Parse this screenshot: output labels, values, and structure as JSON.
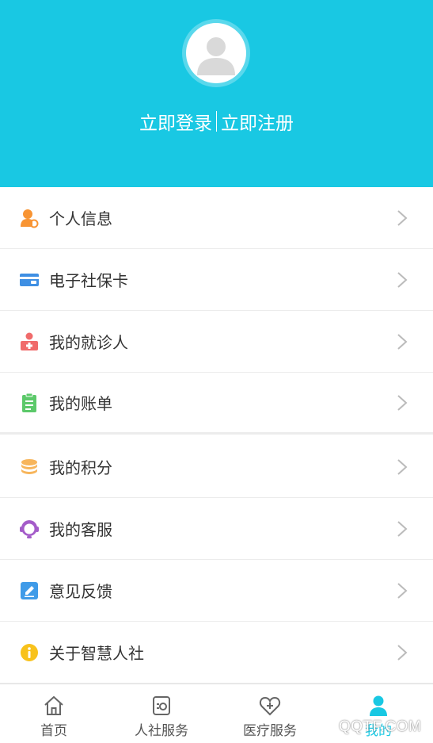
{
  "header": {
    "login_label": "立即登录",
    "register_label": "立即注册",
    "background_color": "#19c8e3"
  },
  "menu": {
    "items": [
      {
        "label": "个人信息",
        "icon": "person-info-icon",
        "color": "#f89433"
      },
      {
        "label": "电子社保卡",
        "icon": "social-security-card-icon",
        "color": "#3f8fe3"
      },
      {
        "label": "我的就诊人",
        "icon": "patient-icon",
        "color": "#f06b6b"
      },
      {
        "label": "我的账单",
        "icon": "bill-clipboard-icon",
        "color": "#5cc96a"
      },
      {
        "label": "我的积分",
        "icon": "points-coins-icon",
        "color": "#f7b55b"
      },
      {
        "label": "我的客服",
        "icon": "customer-service-icon",
        "color": "#a45cc9"
      },
      {
        "label": "意见反馈",
        "icon": "feedback-edit-icon",
        "color": "#3f9be8"
      },
      {
        "label": "关于智慧人社",
        "icon": "info-icon",
        "color": "#f8c21c"
      }
    ]
  },
  "tabbar": {
    "tabs": [
      {
        "label": "首页",
        "icon": "home-icon",
        "active": false
      },
      {
        "label": "人社服务",
        "icon": "social-service-icon",
        "active": false
      },
      {
        "label": "医疗服务",
        "icon": "medical-service-icon",
        "active": false
      },
      {
        "label": "我的",
        "icon": "user-icon",
        "active": true
      }
    ],
    "active_color": "#19c8e3"
  },
  "watermark": "QQTF.COM"
}
